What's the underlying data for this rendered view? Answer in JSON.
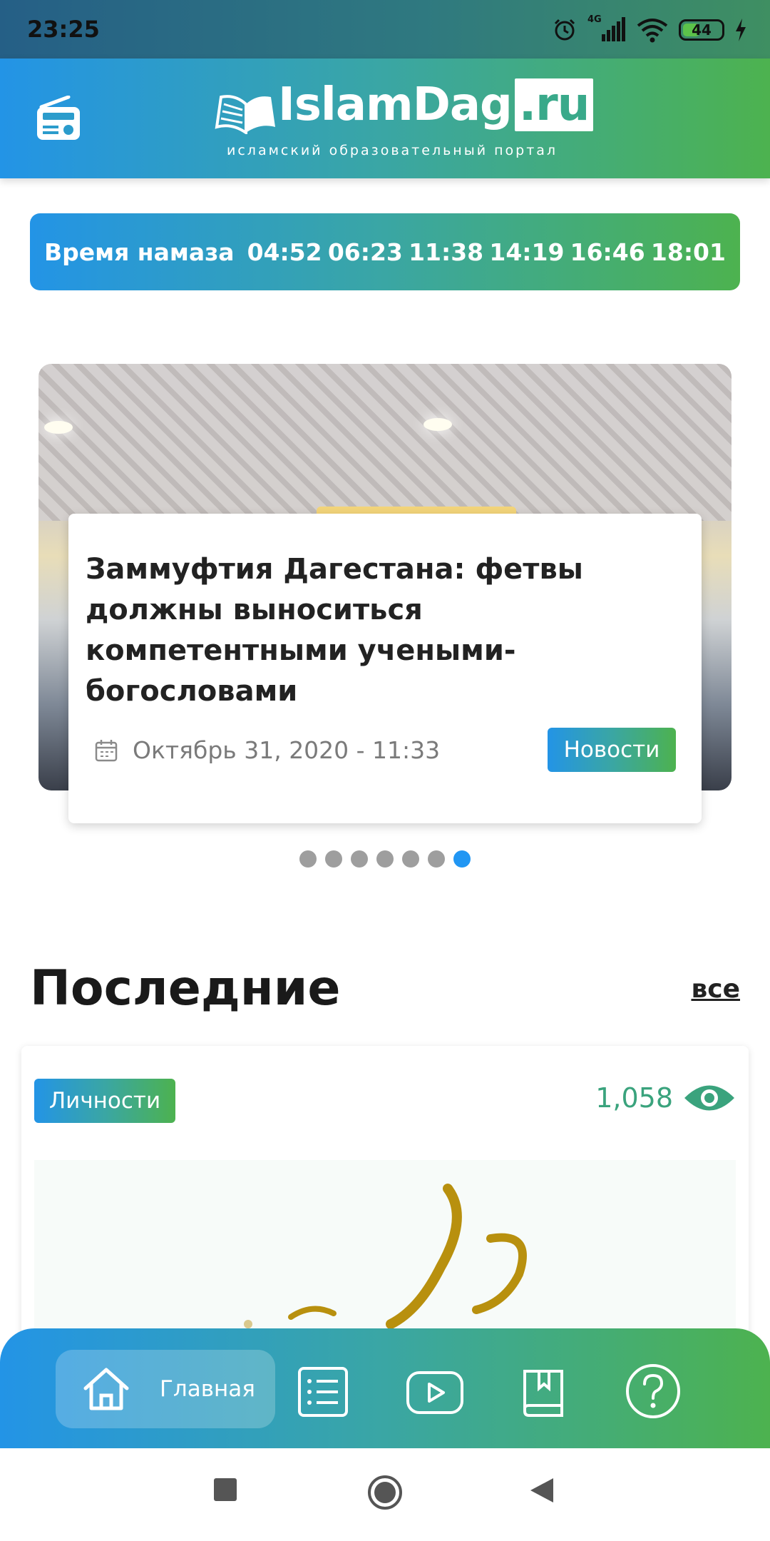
{
  "status_bar": {
    "time": "23:25",
    "network": "4G",
    "battery": "44",
    "icons": [
      "alarm-icon",
      "signal-icon",
      "wifi-icon",
      "battery-icon",
      "charging-icon"
    ]
  },
  "header": {
    "brand_main": "IslamDag",
    "brand_suffix": ".ru",
    "tagline": "исламский образовательный портал",
    "left_icon": "radio-icon"
  },
  "prayer_times": {
    "label": "Время намаза",
    "times": [
      "04:52",
      "06:23",
      "11:38",
      "14:19",
      "16:46",
      "18:01"
    ]
  },
  "slider": {
    "title": "Заммуфтия Дагестана: фетвы должны выноситься компетентными учеными-богословами",
    "date": "Октябрь 31, 2020 - 11:33",
    "category": "Новости",
    "dots_total": 7,
    "active_dot": 7
  },
  "latest": {
    "heading": "Последние",
    "all_link": "все",
    "card": {
      "category": "Личности",
      "views": "1,058"
    }
  },
  "bottom_nav": {
    "home_label": "Главная",
    "items": [
      "home-icon",
      "list-icon",
      "video-icon",
      "book-icon",
      "question-icon"
    ]
  },
  "colors": {
    "gradient_start": "#2394e6",
    "gradient_mid": "#3aa6a4",
    "gradient_end": "#4db24f",
    "active_dot": "#2196f3",
    "views_color": "#3aa37d"
  }
}
